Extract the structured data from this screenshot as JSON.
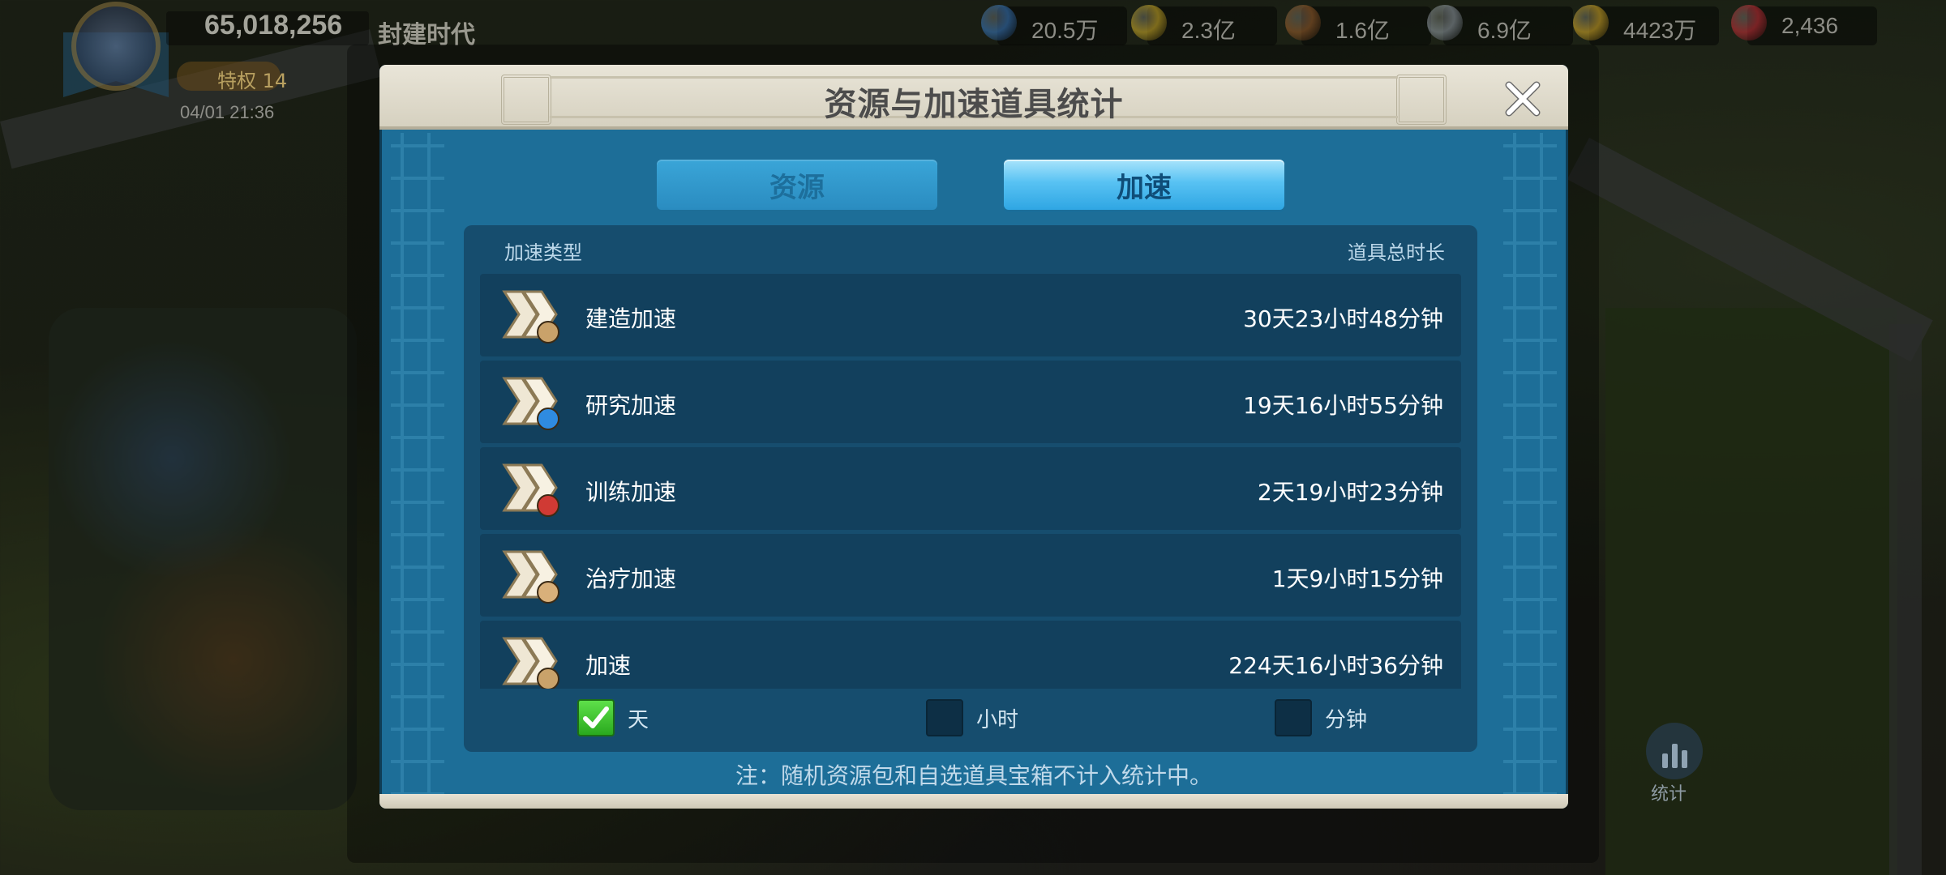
{
  "hud": {
    "power": "65,018,256",
    "era": "封建时代",
    "vip": "特权 14",
    "time": "04/01 21:36",
    "resources": [
      {
        "icon": "gem-blue-icon",
        "value": "20.5万",
        "color": "#3b7ec8"
      },
      {
        "icon": "food-corn-icon",
        "value": "2.3亿",
        "color": "#d8b52a"
      },
      {
        "icon": "wood-log-icon",
        "value": "1.6亿",
        "color": "#a0622e"
      },
      {
        "icon": "stone-icon",
        "value": "6.9亿",
        "color": "#9aa4ad"
      },
      {
        "icon": "gold-coin-icon",
        "value": "4423万",
        "color": "#e0b22a"
      },
      {
        "icon": "ruby-gem-icon",
        "value": "2,436",
        "color": "#d0303a"
      }
    ]
  },
  "modal": {
    "title": "资源与加速道具统计",
    "tabs": {
      "resources": "资源",
      "speedups": "加速"
    },
    "active_tab": "speedups",
    "columns": {
      "type": "加速类型",
      "total": "道具总时长"
    },
    "rows": [
      {
        "label": "建造加速",
        "value": "30天23小时48分钟",
        "badge": "hammer",
        "badge_color": "#c9a26a"
      },
      {
        "label": "研究加速",
        "value": "19天16小时55分钟",
        "badge": "flask",
        "badge_color": "#2f8be0"
      },
      {
        "label": "训练加速",
        "value": "2天19小时23分钟",
        "badge": "medal",
        "badge_color": "#d03a34"
      },
      {
        "label": "治疗加速",
        "value": "1天9小时15分钟",
        "badge": "bandage",
        "badge_color": "#d9b07a"
      },
      {
        "label": "加速",
        "value": "224天16小时36分钟",
        "badge": "generic",
        "badge_color": "#c9a26a"
      }
    ],
    "units": [
      {
        "label": "天",
        "checked": true
      },
      {
        "label": "小时",
        "checked": false
      },
      {
        "label": "分钟",
        "checked": false
      }
    ],
    "footnote": "注：随机资源包和自选道具宝箱不计入统计中。"
  },
  "side": {
    "stats_label": "统计"
  }
}
